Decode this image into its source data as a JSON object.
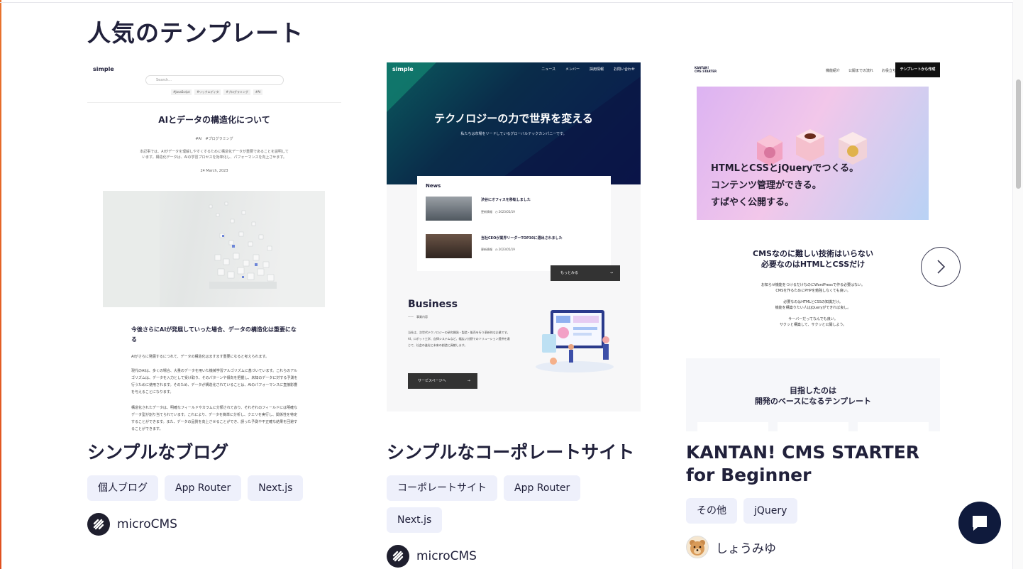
{
  "section_title": "人気のテンプレート",
  "cards": [
    {
      "title": "シンプルなブログ",
      "tags": [
        "個人ブログ",
        "App Router",
        "Next.js"
      ],
      "author": "microCMS",
      "preview": {
        "logo": "simple",
        "search_placeholder": "Search...",
        "tags": [
          "#JavaScript",
          "#リッチエディタ",
          "#プログラミング",
          "#AI"
        ],
        "heading": "AIとデータの構造化について",
        "post_tags": "#AI　#プログラミング",
        "summary": "本記事では、AIがデータを理解しやすくするために構造化データが重要であることを説明しています。構造化データは、AIの学習プロセスを効率化し、パフォーマンスを向上させます。",
        "date": "24 March, 2023",
        "subheading": "今後さらにAIが発展していった場合、データの構造化は重要になる",
        "para1": "AIがさらに発展するにつれて、データの構造化はますます重要になると考えられます。",
        "para2": "現代のAIは、多くの場合、大量のデータを用いた機械学習アルゴリズムに基づいています。これらのアルゴリズムは、データを入力として受け取り、そのパターンや傾向を把握し、未知のデータに対する予測を行うために使用されます。そのため、データが構造化されていることは、AIのパフォーマンスに直接影響を与えることになります。",
        "para3": "構造化されたデータは、明確なフィールドやカラムに分類されており、それぞれのフィールドには明確なデータ型が割り当てられています。これにより、データを簡単に分析し、クエリを実行し、関係性を特定することができます。また、データの品質を向上させることができ、誤った予測や不正確な結果を回避することができます。"
      }
    },
    {
      "title": "シンプルなコーポレートサイト",
      "tags": [
        "コーポレートサイト",
        "App Router",
        "Next.js"
      ],
      "author": "microCMS",
      "preview": {
        "logo": "simple",
        "nav": [
          "ニュース",
          "メンバー",
          "採用情報",
          "お問い合わせ"
        ],
        "hero_title": "テクノロジーの力で世界を変える",
        "hero_sub": "私たちは市場をリードしているグローバルテックカンパニーです。",
        "news_heading": "News",
        "news": [
          {
            "title": "渋谷にオフィスを移転しました",
            "category": "更新情報",
            "date": "2023/05/19"
          },
          {
            "title": "当社CEOが業界リーダーTOP30に選出されました",
            "category": "更新情報",
            "date": "2023/05/19"
          }
        ],
        "more": "もっとみる",
        "business_heading": "Business",
        "business_sub": "事業内容",
        "business_text": "当社は、次世代テクノロジーの研究開発・製造・販売を行う革新的な企業です。AI、ロボット工学、自律システムなど、幅広い分野でのソリューション提供を通じて、社会の進化と未来の創造に貢献します。",
        "service": "サービスページへ"
      }
    },
    {
      "title": "KANTAN! CMS STARTER for Beginner",
      "tags": [
        "その他",
        "jQuery"
      ],
      "author": "しょうみゆ",
      "preview": {
        "logo_line1": "KANTAN!",
        "logo_line2": "CMS STARTER",
        "nav": [
          "機能紹介",
          "公開までの流れ",
          "お役立ちコラム"
        ],
        "cta": "テンプレートから作成",
        "hero_lines": [
          "HTMLとCSSとjQueryでつくる。",
          "コンテンツ管理ができる。",
          "すばやく公開する。"
        ],
        "heading_lines": [
          "CMSなのに難しい技術はいらない",
          "必要なのはHTMLとCSSだけ"
        ],
        "para_lines": [
          "お知らせ機能をつけるだけなのにWordPressで作る必要はない。",
          "CMSを作るためにPHPを勉強しなくても良い。",
          "",
          "必要なのはHTMLとCSSの知識だけ。",
          "機能を構築りたい人はjQueryができれば良し。",
          "",
          "サーバーだってなんでも良い。",
          "サクッと構築して、サクッと公開しよう。"
        ],
        "box_heading_lines": [
          "目指したのは",
          "開発のベースになるテンプレート"
        ]
      }
    }
  ],
  "icons": {
    "next": "chevron-right-icon",
    "chat": "chat-icon",
    "author_logo": "microcms-logo-icon",
    "author_avatar": "bear-avatar-icon"
  },
  "colors": {
    "text": "#21213b",
    "tag_bg": "#eef0fb",
    "chat_bg": "#0f1a3c"
  }
}
